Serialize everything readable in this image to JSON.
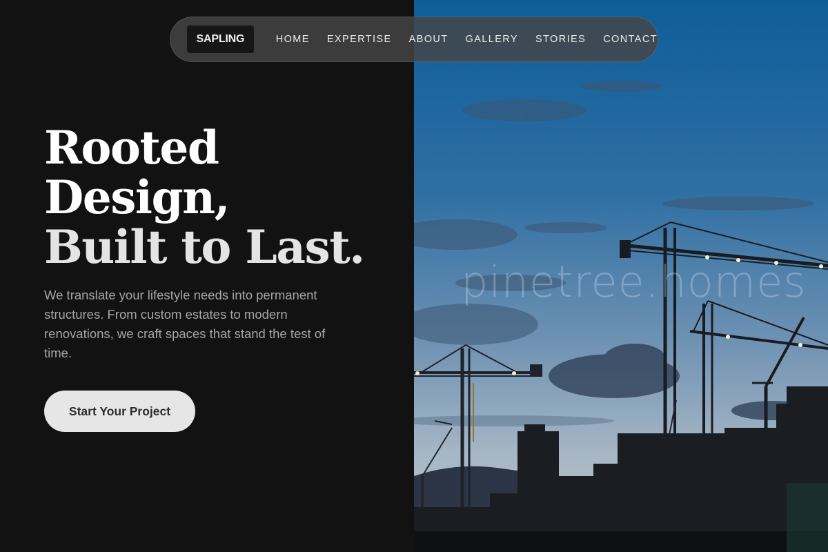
{
  "nav": {
    "brand": "SAPLING",
    "links": [
      "HOME",
      "EXPERTISE",
      "ABOUT",
      "GALLERY",
      "STORIES",
      "CONTACT"
    ]
  },
  "hero": {
    "headline_lines": [
      "Rooted",
      "Design,",
      "Built to Last."
    ],
    "body": "We translate your lifestyle needs into permanent structures. From custom estates to modern renovations, we craft spaces that stand the test of time.",
    "cta_label": "Start Your Project"
  },
  "image": {
    "watermark": "pinetree.homes"
  },
  "colors": {
    "background": "#121212",
    "cta_background": "#e6e6e6",
    "sky_top": "#0e5d9a",
    "sky_bottom": "#9fb4c6"
  }
}
